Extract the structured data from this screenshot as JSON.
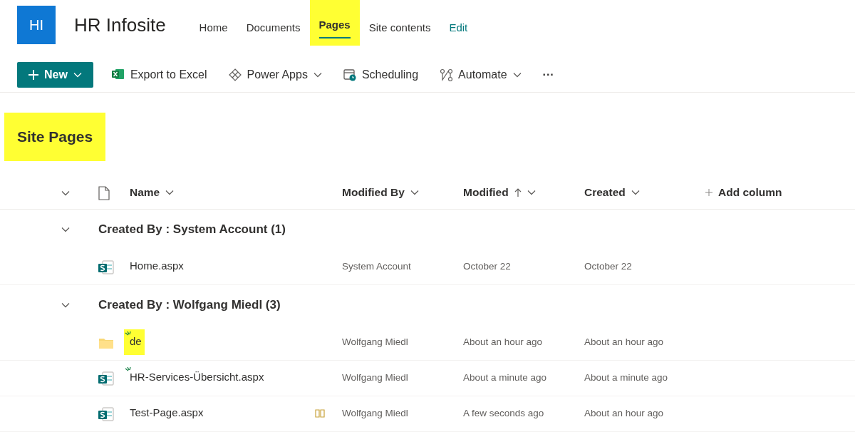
{
  "site": {
    "logo": "HI",
    "title": "HR Infosite"
  },
  "nav": [
    {
      "label": "Home",
      "selected": false,
      "highlighted": false,
      "kind": "link"
    },
    {
      "label": "Documents",
      "selected": false,
      "highlighted": false,
      "kind": "link"
    },
    {
      "label": "Pages",
      "selected": true,
      "highlighted": true,
      "kind": "link"
    },
    {
      "label": "Site contents",
      "selected": false,
      "highlighted": false,
      "kind": "link"
    },
    {
      "label": "Edit",
      "selected": false,
      "highlighted": false,
      "kind": "edit"
    }
  ],
  "commands": [
    {
      "label": "New",
      "kind": "primary",
      "dropdown": true
    },
    {
      "label": "Export to Excel",
      "kind": "excel",
      "dropdown": false
    },
    {
      "label": "Power Apps",
      "kind": "powerapps",
      "dropdown": true
    },
    {
      "label": "Scheduling",
      "kind": "scheduling",
      "dropdown": false
    },
    {
      "label": "Automate",
      "kind": "automate",
      "dropdown": true
    },
    {
      "label": "···",
      "kind": "more",
      "dropdown": false
    }
  ],
  "list": {
    "title": "Site Pages",
    "highlighted": true,
    "columns": [
      {
        "label": "Name",
        "sorted_ascending": false
      },
      {
        "label": "Modified By",
        "sorted_ascending": false
      },
      {
        "label": "Modified",
        "sorted_ascending": true
      },
      {
        "label": "Created",
        "sorted_ascending": false
      }
    ],
    "add_column": "Add column",
    "groups": [
      {
        "label": "Created By : System Account (1)",
        "expanded": true,
        "rows": [
          {
            "kind": "page",
            "name": "Home.aspx",
            "new": false,
            "highlighted": false,
            "editing": false,
            "modified_by": "System Account",
            "modified": "October 22",
            "created": "October 22"
          }
        ]
      },
      {
        "label": "Created By : Wolfgang Miedl (3)",
        "expanded": true,
        "rows": [
          {
            "kind": "folder",
            "name": "de",
            "new": true,
            "highlighted": true,
            "editing": false,
            "modified_by": "Wolfgang Miedl",
            "modified": "About an hour ago",
            "created": "About an hour ago"
          },
          {
            "kind": "page",
            "name": "HR-Services-Übersicht.aspx",
            "new": true,
            "highlighted": false,
            "editing": false,
            "modified_by": "Wolfgang Miedl",
            "modified": "About a minute ago",
            "created": "About a minute ago"
          },
          {
            "kind": "page",
            "name": "Test-Page.aspx",
            "new": false,
            "highlighted": false,
            "editing": true,
            "modified_by": "Wolfgang Miedl",
            "modified": "A few seconds ago",
            "created": "About an hour ago"
          }
        ]
      }
    ]
  }
}
